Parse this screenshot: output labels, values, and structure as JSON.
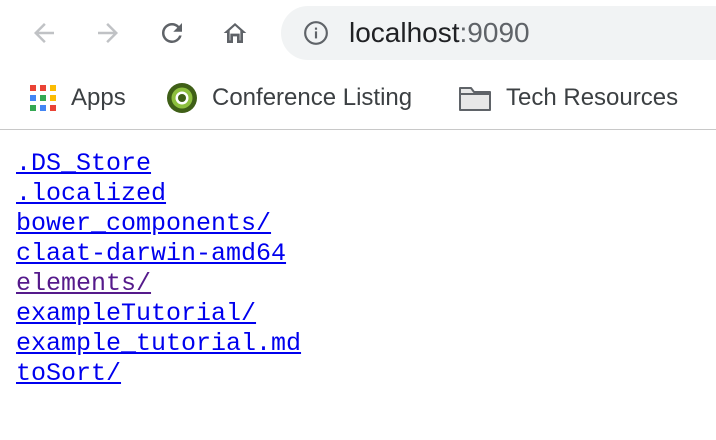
{
  "browser": {
    "address": {
      "host": "localhost",
      "port": ":9090"
    },
    "bookmarks": [
      {
        "label": "Apps",
        "icon": "apps-grid-icon"
      },
      {
        "label": "Conference Listing",
        "icon": "dl-logo-icon"
      },
      {
        "label": "Tech Resources",
        "icon": "folder-icon"
      }
    ]
  },
  "listing": {
    "items": [
      {
        "name": ".DS_Store",
        "visited": false
      },
      {
        "name": ".localized",
        "visited": false
      },
      {
        "name": "bower_components/",
        "visited": false
      },
      {
        "name": "claat-darwin-amd64",
        "visited": false
      },
      {
        "name": "elements/",
        "visited": true
      },
      {
        "name": "exampleTutorial/",
        "visited": false
      },
      {
        "name": "example_tutorial.md",
        "visited": false
      },
      {
        "name": "toSort/",
        "visited": false
      }
    ]
  },
  "colors": {
    "link": "#0000ee",
    "visited_link": "#551a8b",
    "omnibox_bg": "#f1f3f4"
  }
}
